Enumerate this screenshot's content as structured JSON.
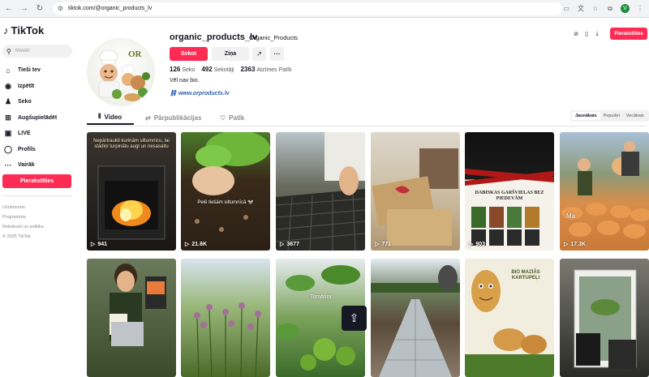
{
  "browser": {
    "url": "tiktok.com/@organic_products_lv",
    "profile_initial": "V"
  },
  "sidebar": {
    "logo": "TikTok",
    "search_placeholder": "Meklēt",
    "items": [
      {
        "icon": "home-icon",
        "glyph": "⌂",
        "label": "Tieši tev"
      },
      {
        "icon": "explore-icon",
        "glyph": "◉",
        "label": "Izpētīt"
      },
      {
        "icon": "following-icon",
        "glyph": "♟",
        "label": "Seko"
      },
      {
        "icon": "upload-icon",
        "glyph": "⊞",
        "label": "Augšupielādēt"
      },
      {
        "icon": "live-icon",
        "glyph": "▣",
        "label": "LIVE"
      },
      {
        "icon": "profile-icon",
        "glyph": "◯",
        "label": "Profils"
      },
      {
        "icon": "more-icon",
        "glyph": "···",
        "label": "Vairāk"
      }
    ],
    "login_label": "Pierakstīties",
    "footer": [
      "Uzņēmums",
      "Programma",
      "Noteikumi un politika",
      "© 2025 TikTok"
    ]
  },
  "profile": {
    "username": "organic_products_lv",
    "nickname": "Organic_Products",
    "follow_label": "Sekot",
    "message_label": "Ziņa",
    "stats": [
      {
        "value": "126",
        "label": "Seko"
      },
      {
        "value": "492",
        "label": "Sekotāji"
      },
      {
        "value": "2363",
        "label": "Atzīmes Patīk"
      }
    ],
    "bio": "Vēl nav bio.",
    "link": "www.orproducts.lv"
  },
  "top_right": {
    "login_label": "Pierakstīties"
  },
  "tabs": [
    {
      "label": "Video",
      "icon": "grid-icon",
      "glyph": "⦀"
    },
    {
      "label": "Pārpublikācijas",
      "icon": "repost-icon",
      "glyph": "⇄"
    },
    {
      "label": "Patīk",
      "icon": "like-icon",
      "glyph": "♡"
    }
  ],
  "sort": [
    "Jaunākais",
    "Populāri",
    "Vecākais"
  ],
  "videos": [
    {
      "caption": "Nepārtraukti kurinām siltumnīcu, lai stādiņi turpinātu augt un nesasaltu",
      "views": "941"
    },
    {
      "caption": "Pelē tiešām siltumnīcā 🐭",
      "views": "21.6K"
    },
    {
      "caption": "",
      "views": "3677"
    },
    {
      "caption": "",
      "views": "771"
    },
    {
      "caption": "DABISKAS GARŠVIELAS BEZ PIEDEVĀM",
      "views": "903"
    },
    {
      "caption": "Ma",
      "views": "17.3K"
    },
    {
      "caption": "",
      "views": ""
    },
    {
      "caption": "",
      "views": ""
    },
    {
      "caption": "Tomātiņi",
      "views": ""
    },
    {
      "caption": "",
      "views": ""
    },
    {
      "caption": "BIO MAZIĀS KARTUPEĻI",
      "views": ""
    },
    {
      "caption": "",
      "views": ""
    }
  ]
}
